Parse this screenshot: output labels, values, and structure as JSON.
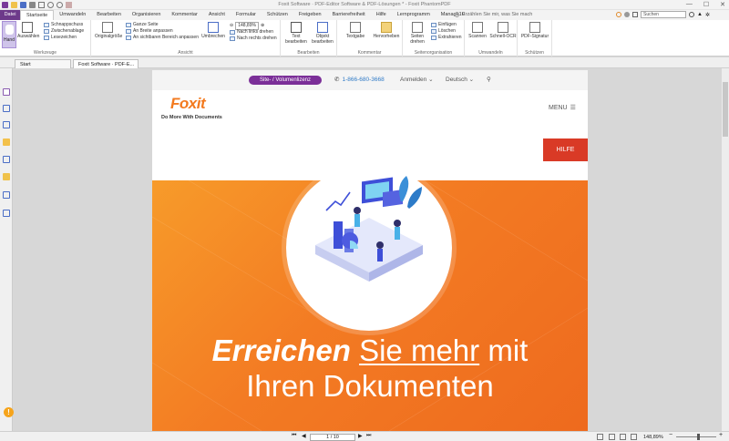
{
  "title_bar": {
    "text": "Foxit Software · PDF-Editor Software & PDF-Lösungen * - Foxit PhantomPDF",
    "minimize": "—",
    "maximize": "☐",
    "close": "✕"
  },
  "ribbon_tabs": [
    "Datei",
    "Startseite",
    "Umwandeln",
    "Bearbeiten",
    "Organisieren",
    "Kommentar",
    "Ansicht",
    "Formular",
    "Schützen",
    "Freigeben",
    "Barrierefreiheit",
    "Hilfe",
    "Lernprogramm",
    "Manage10"
  ],
  "tell_me": "Erzählen Sie mir, was Sie mach",
  "search_placeholder": "Suchen",
  "ribbon": {
    "werkzeuge": {
      "label": "Werkzeuge",
      "hand": "Hand",
      "auswaehlen": "Auswählen",
      "schnappschuss": "Schnappschuss",
      "zwischenablage": "Zwischenablage",
      "lesezeichen": "Lesezeichen"
    },
    "ansicht": {
      "label": "Ansicht",
      "originalgroesse": "Originalgröße",
      "ganze_seite": "Ganze Seite",
      "an_breite": "An Breite anpassen",
      "an_sichtbaren": "An sichtbaren Bereich anpassen",
      "umbrechen": "Umbrechen",
      "zoom": "148,89%",
      "links_drehen": "Nach links drehen",
      "rechts_drehen": "Nach rechts drehen"
    },
    "bearbeiten": {
      "label": "Bearbeiten",
      "text": "Text bearbeiten",
      "objekt": "Objekt bearbeiten"
    },
    "kommentar": {
      "label": "Kommentar",
      "textgabe": "Textgabe",
      "hervorheben": "Hervorheben"
    },
    "seitenorg": {
      "label": "Seitenorganisation",
      "seiten_drehen": "Seiten drehen",
      "einfuegen": "Einfügen",
      "loeschen": "Löschen",
      "extrahieren": "Extrahieren"
    },
    "umwandeln": {
      "label": "Umwandeln",
      "scannen": "Scannen",
      "schnell_ocr": "Schnell-OCR"
    },
    "schuetzen": {
      "label": "Schützen",
      "signatur": "PDF-Signatur"
    }
  },
  "doc_tabs": [
    "Start",
    "Foxit Software · PDF-E..."
  ],
  "webpage": {
    "pill": "Site- / Volumenlizenz",
    "phone": "1-866-680-3668",
    "anmelden": "Anmelden",
    "language": "Deutsch",
    "logo": "Foxit",
    "tagline": "Do More With Documents",
    "menu": "MENU",
    "hilfe": "HILFE",
    "headline_bold": "Erreichen",
    "headline_underline": "Sie mehr",
    "headline_rest": "mit",
    "headline_line2": "Ihren Dokumenten"
  },
  "status": {
    "page": "1 / 10",
    "zoom": "148,89%"
  },
  "colors": {
    "accent": "#6d3a8a",
    "orange": "#f37b23",
    "red": "#d93a26",
    "pill": "#7b2f98"
  }
}
